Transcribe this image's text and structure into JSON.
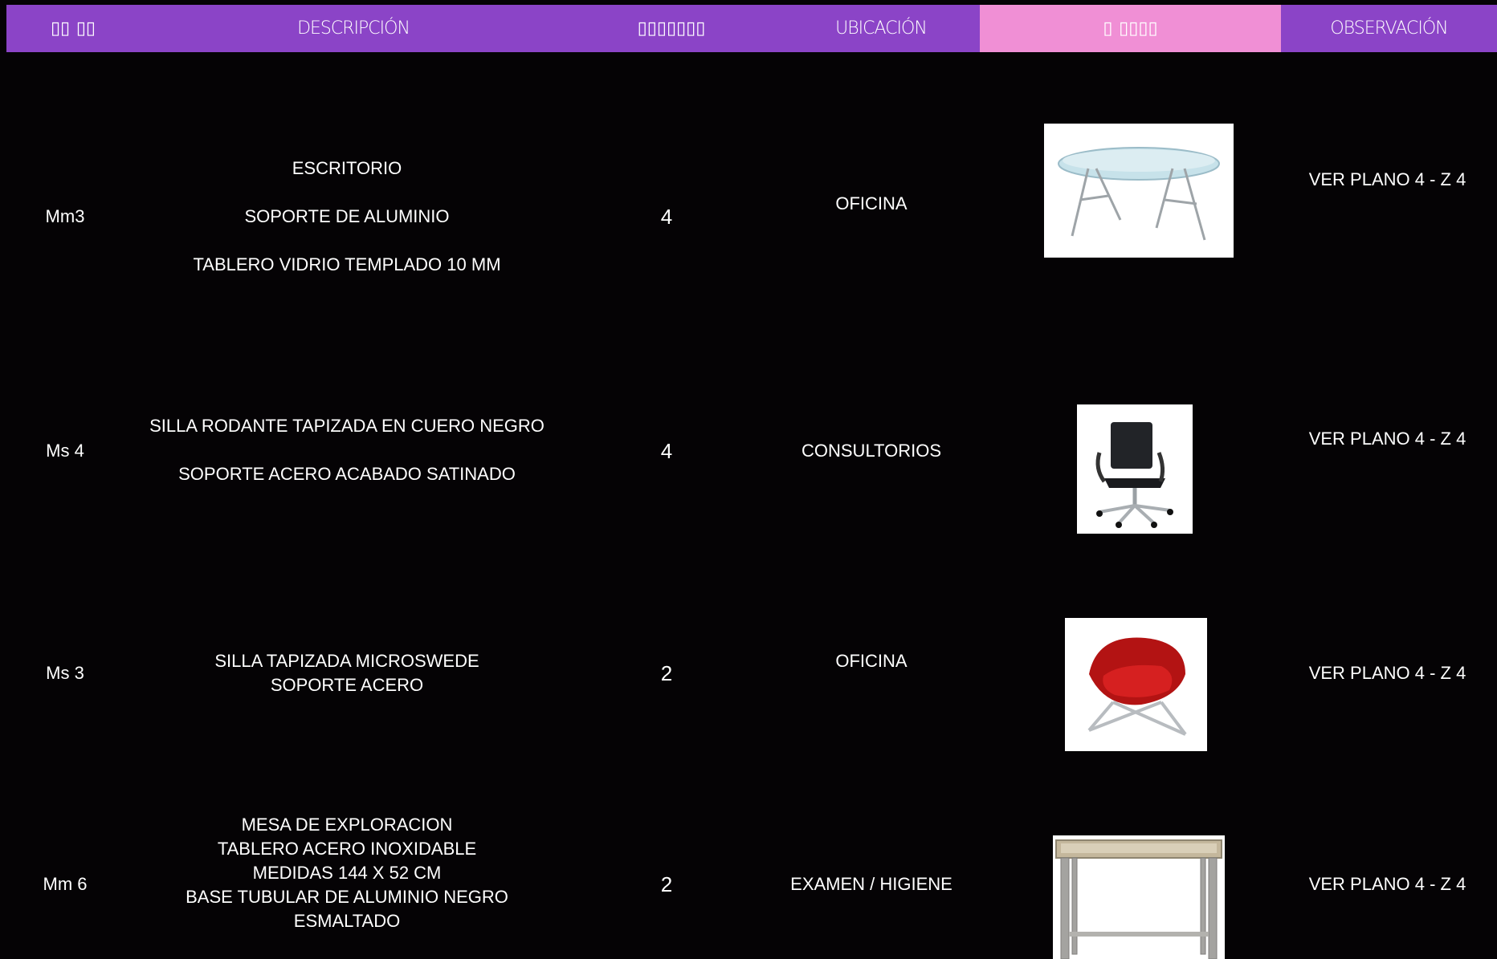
{
  "header": {
    "col_code": "▯▯ ▯▯",
    "col_description": "DESCRIPCIÓN",
    "col_quantity": "▯▯▯▯▯▯▯",
    "col_location": "UBICACIÓN",
    "col_image": "▯ ▯▯▯▯",
    "col_observation": "OBSERVACIÓN"
  },
  "colors": {
    "header_bg": "#8b44c7",
    "image_header_bg": "#f08fd5",
    "page_bg": "#050305",
    "text": "#ffffff"
  },
  "rows": [
    {
      "code": "Mm3",
      "description": [
        "ESCRITORIO",
        "SOPORTE  DE ALUMINIO",
        "TABLERO VIDRIO  TEMPLADO 10  MM"
      ],
      "quantity": "4",
      "location": "OFICINA",
      "image_icon": "glass-desk-icon",
      "observation": "VER PLANO 4 - Z 4"
    },
    {
      "code": "Ms 4",
      "description": [
        "SILLA  RODANTE TAPIZADA EN CUERO NEGRO",
        "SOPORTE ACERO ACABADO SATINADO"
      ],
      "quantity": "4",
      "location": "CONSULTORIOS",
      "image_icon": "office-chair-icon",
      "observation": "VER PLANO 4 - Z 4"
    },
    {
      "code": "Ms 3",
      "description": [
        "SILLA   TAPIZADA MICROSWEDE",
        "SOPORTE ACERO"
      ],
      "quantity": "2",
      "location": "OFICINA",
      "image_icon": "red-lounge-chair-icon",
      "observation": "VER PLANO 4 - Z 4"
    },
    {
      "code": "Mm 6",
      "description": [
        "MESA DE EXPLORACION",
        "TABLERO ACERO INOXIDABLE",
        "MEDIDAS 144 X 52 CM",
        "BASE TUBULAR DE ALUMINIO NEGRO",
        "ESMALTADO"
      ],
      "quantity": "2",
      "location": "EXAMEN /  HIGIENE",
      "image_icon": "exam-table-icon",
      "observation": "VER PLANO 4 - Z 4"
    }
  ]
}
